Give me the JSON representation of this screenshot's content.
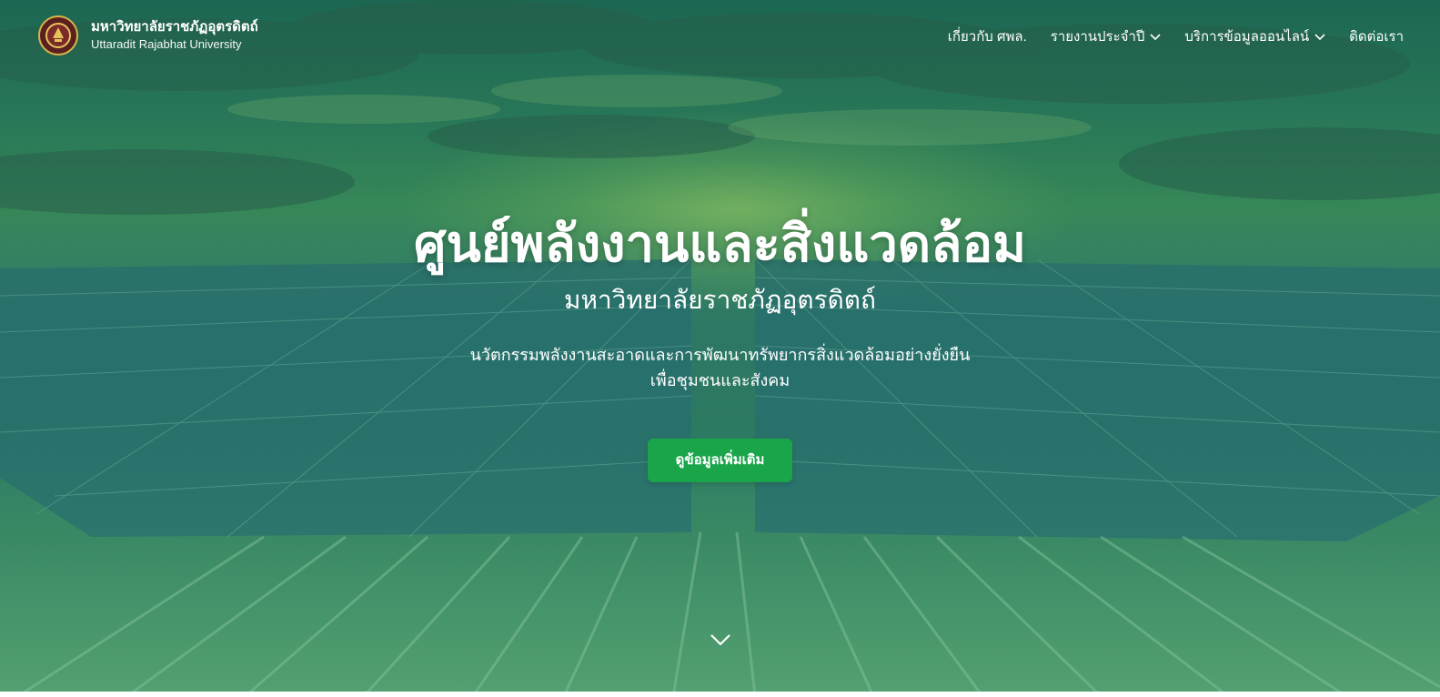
{
  "header": {
    "brand_th": "มหาวิทยาลัยราชภัฏอุตรดิตถ์",
    "brand_en": "Uttaradit Rajabhat University",
    "logo_icon": "university-seal-icon",
    "nav": [
      {
        "label": "เกี่ยวกับ ศพล.",
        "has_dropdown": false
      },
      {
        "label": "รายงานประจำปี",
        "has_dropdown": true
      },
      {
        "label": "บริการข้อมูลออนไลน์",
        "has_dropdown": true
      },
      {
        "label": "ติดต่อเรา",
        "has_dropdown": false
      }
    ]
  },
  "hero": {
    "title": "ศูนย์พลังงานและสิ่งแวดล้อม",
    "subtitle": "มหาวิทยาลัยราชภัฏอุตรดิตถ์",
    "description_line1": "นวัตกรรมพลังงานสะอาดและการพัฒนาทรัพยากรสิ่งแวดล้อมอย่างยั่งยืน",
    "description_line2": "เพื่อชุมชนและสังคม",
    "cta_label": "ดูข้อมูลเพิ่มเติม",
    "scroll_icon": "chevron-down-icon"
  },
  "colors": {
    "accent": "#1aa54b",
    "text": "#ffffff",
    "overlay": "#2f7b66"
  }
}
